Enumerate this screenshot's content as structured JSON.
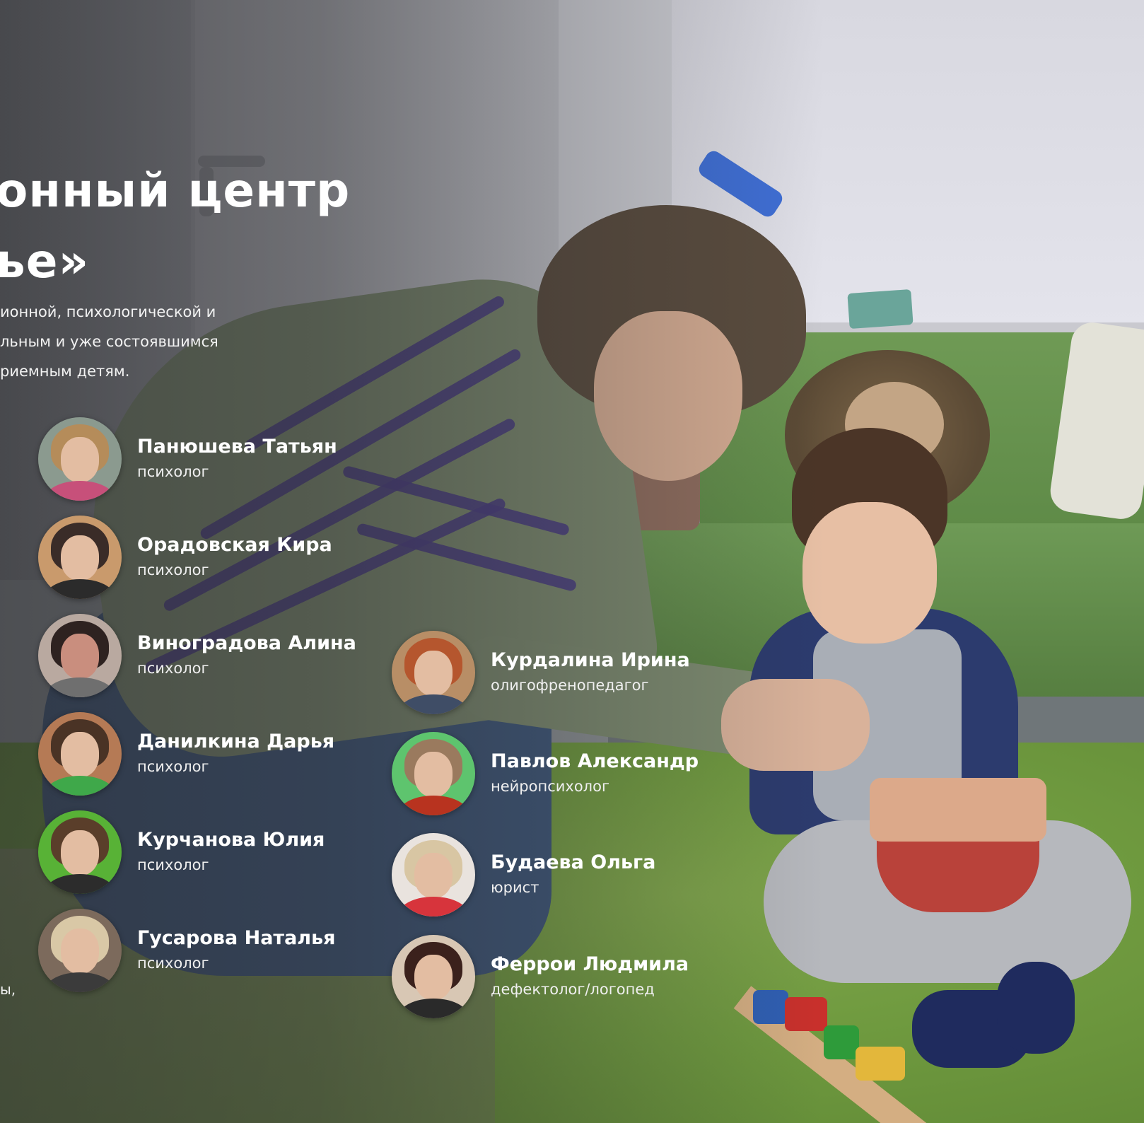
{
  "hero": {
    "title_line1": "онный центр",
    "title_line2": "ье»",
    "intro_line1": "ионной, психологической и",
    "intro_line2": "льным и уже состоявшимся",
    "intro_line3": "риемным детям.",
    "cut_fragment": "ы,"
  },
  "specialists_left": [
    {
      "name": "Панюшева Татьян",
      "role": "психолог"
    },
    {
      "name": "Орадовская Кира",
      "role": "психолог"
    },
    {
      "name": "Виноградова Алина",
      "role": "психолог"
    },
    {
      "name": "Данилкина Дарья",
      "role": "психолог"
    },
    {
      "name": "Курчанова Юлия",
      "role": "психолог"
    },
    {
      "name": "Гусарова Наталья",
      "role": "психолог"
    }
  ],
  "specialists_right": [
    {
      "name": "Курдалина Ирина",
      "role": "олигофренопедагог"
    },
    {
      "name": "Павлов Александр",
      "role": "нейропсихолог"
    },
    {
      "name": "Будаева Ольга",
      "role": "юрист"
    },
    {
      "name": "Феррои Людмила",
      "role": "дефектолог/логопед"
    }
  ]
}
